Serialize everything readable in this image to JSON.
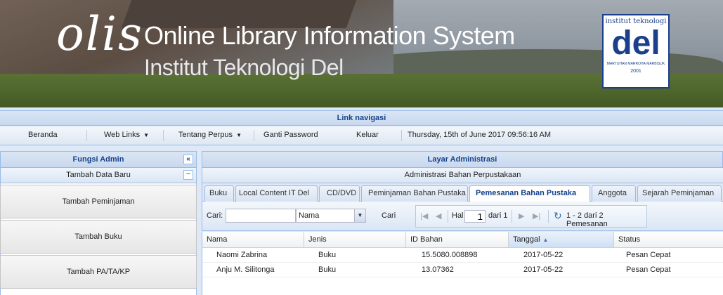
{
  "header": {
    "logo_text": "olis",
    "title_line1": "Online Library Information System",
    "title_line2": "Institut Teknologi Del",
    "badge": {
      "top": "institut teknologi",
      "main": "del",
      "motto": "MARTUHAN MARROHA MARBISUK",
      "year": "2001"
    }
  },
  "nav": {
    "title": "Link navigasi",
    "items": [
      "Beranda",
      "Web Links",
      "Tentang Perpus",
      "Ganti Password",
      "Keluar"
    ],
    "datetime": "Thursday, 15th of June 2017 09:56:16 AM"
  },
  "left": {
    "title": "Fungsi Admin",
    "collapse_glyph": "«",
    "section": "Tambah Data Baru",
    "section_toggle": "−",
    "buttons": [
      "Tambah Peminjaman",
      "Tambah Buku",
      "Tambah PA/TA/KP"
    ]
  },
  "right": {
    "title": "Layar Administrasi",
    "subtitle": "Administrasi Bahan Perpustakaan",
    "tabs": [
      "Buku",
      "Local Content IT Del",
      "CD/DVD",
      "Peminjaman Bahan Pustaka",
      "Pemesanan Bahan Pustaka",
      "Anggota",
      "Sejarah Peminjaman"
    ],
    "active_tab": "Pemesanan Bahan Pustaka"
  },
  "toolbar": {
    "search_label": "Cari:",
    "search_value": "",
    "filter_selected": "Nama",
    "search_button": "Cari",
    "page_label": "Hal",
    "page_value": "1",
    "page_of": "dari 1",
    "display_msg": "1 - 2 dari 2 Pemesanan"
  },
  "grid": {
    "columns": [
      "Nama",
      "Jenis",
      "ID Bahan",
      "Tanggal",
      "Status"
    ],
    "sorted_column": "Tanggal",
    "rows": [
      [
        "Naomi Zabrina",
        "Buku",
        "15.5080.008898",
        "2017-05-22",
        "Pesan Cepat"
      ],
      [
        "Anju M. Silitonga",
        "Buku",
        "13.07362",
        "2017-05-22",
        "Pesan Cepat"
      ]
    ]
  },
  "colors": {
    "accent": "#15428b",
    "border": "#99bbe8",
    "panel": "#dae6f4"
  }
}
